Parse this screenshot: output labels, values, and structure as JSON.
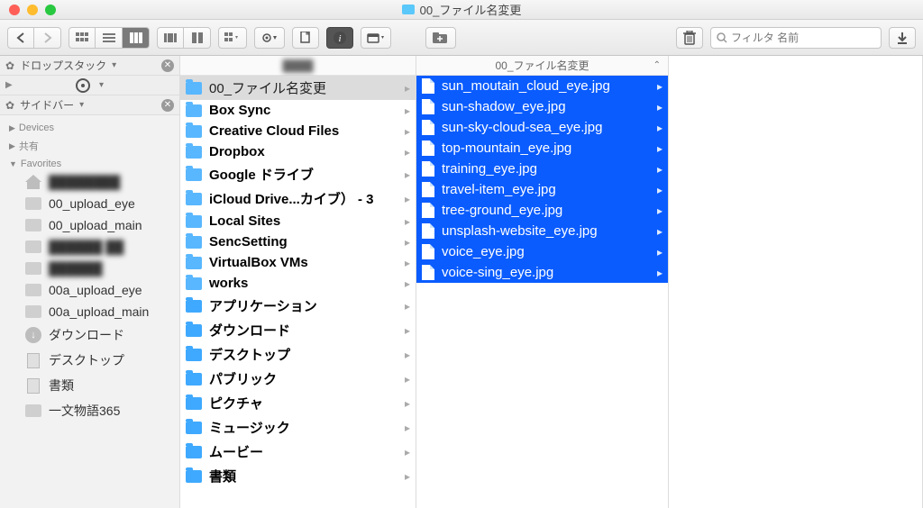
{
  "window": {
    "title": "00_ファイル名変更"
  },
  "toolbar": {
    "search_placeholder": "フィルタ 名前"
  },
  "sidebar": {
    "strip1_label": "ドロップスタック",
    "strip3_label": "サイドバー",
    "sections": {
      "devices": "Devices",
      "shared": "共有",
      "favorites": "Favorites"
    },
    "favorites": [
      {
        "label": "████████",
        "icon": "home",
        "blur": true
      },
      {
        "label": "00_upload_eye",
        "icon": "folder"
      },
      {
        "label": "00_upload_main",
        "icon": "folder"
      },
      {
        "label": "██████ ██",
        "icon": "folder",
        "blur": true
      },
      {
        "label": "██████",
        "icon": "folder",
        "blur": true
      },
      {
        "label": "00a_upload_eye",
        "icon": "folder"
      },
      {
        "label": "00a_upload_main",
        "icon": "folder"
      },
      {
        "label": "ダウンロード",
        "icon": "download"
      },
      {
        "label": "デスクトップ",
        "icon": "doc"
      },
      {
        "label": "書類",
        "icon": "doc"
      },
      {
        "label": "一文物語365",
        "icon": "folder"
      }
    ]
  },
  "col1": {
    "header": "████",
    "items": [
      {
        "label": "00_ファイル名変更",
        "sel": true,
        "bold": false
      },
      {
        "label": "Box Sync",
        "bold": true
      },
      {
        "label": "Creative Cloud Files",
        "bold": true
      },
      {
        "label": "Dropbox",
        "bold": true
      },
      {
        "label": "Google ドライブ",
        "bold": true
      },
      {
        "label": "iCloud Drive...カイブ）  - 3",
        "bold": true
      },
      {
        "label": "Local Sites",
        "bold": true
      },
      {
        "label": "SencSetting",
        "bold": true
      },
      {
        "label": "VirtualBox VMs",
        "bold": true
      },
      {
        "label": "works",
        "bold": true
      },
      {
        "label": "アプリケーション",
        "bold": true,
        "sys": true
      },
      {
        "label": "ダウンロード",
        "bold": true,
        "sys": true
      },
      {
        "label": "デスクトップ",
        "bold": true,
        "sys": true
      },
      {
        "label": "パブリック",
        "bold": true,
        "sys": true
      },
      {
        "label": "ピクチャ",
        "bold": true,
        "sys": true
      },
      {
        "label": "ミュージック",
        "bold": true,
        "sys": true
      },
      {
        "label": "ムービー",
        "bold": true,
        "sys": true
      },
      {
        "label": "書類",
        "bold": true,
        "sys": true
      }
    ]
  },
  "col2": {
    "header": "00_ファイル名変更",
    "items": [
      {
        "label": "sun_moutain_cloud_eye.jpg"
      },
      {
        "label": "sun-shadow_eye.jpg"
      },
      {
        "label": "sun-sky-cloud-sea_eye.jpg"
      },
      {
        "label": "top-mountain_eye.jpg"
      },
      {
        "label": "training_eye.jpg"
      },
      {
        "label": "travel-item_eye.jpg"
      },
      {
        "label": "tree-ground_eye.jpg"
      },
      {
        "label": "unsplash-website_eye.jpg"
      },
      {
        "label": "voice_eye.jpg"
      },
      {
        "label": "voice-sing_eye.jpg"
      }
    ]
  }
}
